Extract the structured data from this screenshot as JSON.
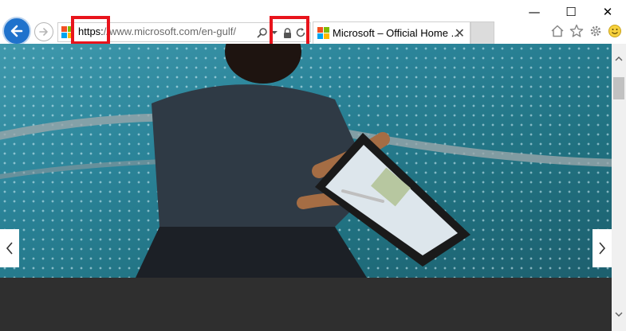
{
  "window": {
    "minimize_glyph": "—",
    "maximize_glyph": "☐",
    "close_glyph": "✕"
  },
  "address_bar": {
    "protocol": "https:",
    "url_rest": "//www.microsoft.com/en-gulf/",
    "icons": [
      "search-icon",
      "dropdown-icon",
      "lock-icon",
      "refresh-icon"
    ]
  },
  "tab": {
    "title": "Microsoft – Official Home ...",
    "close_glyph": "✕"
  },
  "toolbar_icons": [
    "home-icon",
    "favorites-star-icon",
    "settings-gear-icon",
    "feedback-smiley-icon"
  ],
  "colors": {
    "back_button": "#1f72cc",
    "highlight": "#e8141c",
    "hero": "#2b8499",
    "dark_band": "#2f2f2f"
  }
}
